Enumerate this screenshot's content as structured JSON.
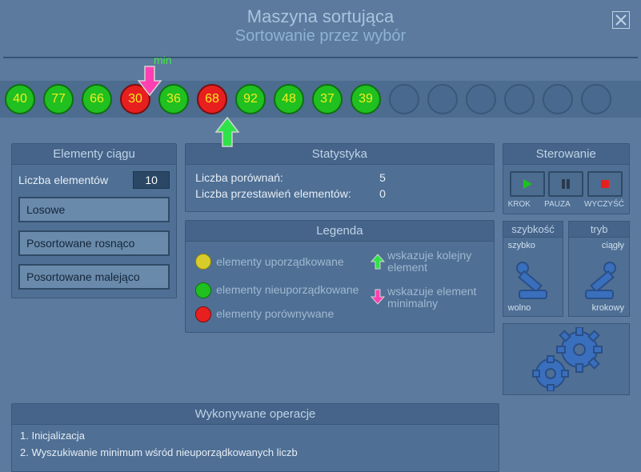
{
  "header": {
    "title": "Maszyna sortująca",
    "subtitle": "Sortowanie przez wybór"
  },
  "strip": {
    "min_label": "min",
    "balls": [
      {
        "value": "40",
        "state": "green"
      },
      {
        "value": "77",
        "state": "green"
      },
      {
        "value": "66",
        "state": "green"
      },
      {
        "value": "30",
        "state": "red"
      },
      {
        "value": "36",
        "state": "green"
      },
      {
        "value": "68",
        "state": "red"
      },
      {
        "value": "92",
        "state": "green"
      },
      {
        "value": "48",
        "state": "green"
      },
      {
        "value": "37",
        "state": "green"
      },
      {
        "value": "39",
        "state": "green"
      }
    ],
    "empty_slots": 6,
    "min_arrow_index": 3,
    "current_arrow_index": 5
  },
  "elements": {
    "title": "Elementy ciągu",
    "count_label": "Liczba elementów",
    "count_value": "10",
    "buttons": {
      "random": "Losowe",
      "asc": "Posortowane rosnąco",
      "desc": "Posortowane malejąco"
    }
  },
  "stats": {
    "title": "Statystyka",
    "rows": [
      {
        "label": "Liczba porównań:",
        "value": "5"
      },
      {
        "label": "Liczba przestawień elementów:",
        "value": "0"
      }
    ]
  },
  "legend": {
    "title": "Legenda",
    "items": {
      "sorted": "elementy uporządkowane",
      "unsorted": "elementy nieuporządkowane",
      "compared": "elementy porównywane",
      "next": "wskazuje kolejny element",
      "minimal": "wskazuje element minimalny"
    }
  },
  "control": {
    "title": "Sterowanie",
    "labels": {
      "step": "KROK",
      "pause": "PAUZA",
      "clear": "WYCZYŚĆ"
    }
  },
  "sliders": {
    "speed": {
      "title": "szybkość",
      "top": "szybko",
      "bottom": "wolno"
    },
    "mode": {
      "title": "tryb",
      "top": "ciągły",
      "bottom": "krokowy"
    }
  },
  "ops": {
    "title": "Wykonywane operacje",
    "lines": [
      "1. Inicjalizacja",
      "2. Wyszukiwanie minimum wśród nieuporządkowanych liczb"
    ]
  }
}
